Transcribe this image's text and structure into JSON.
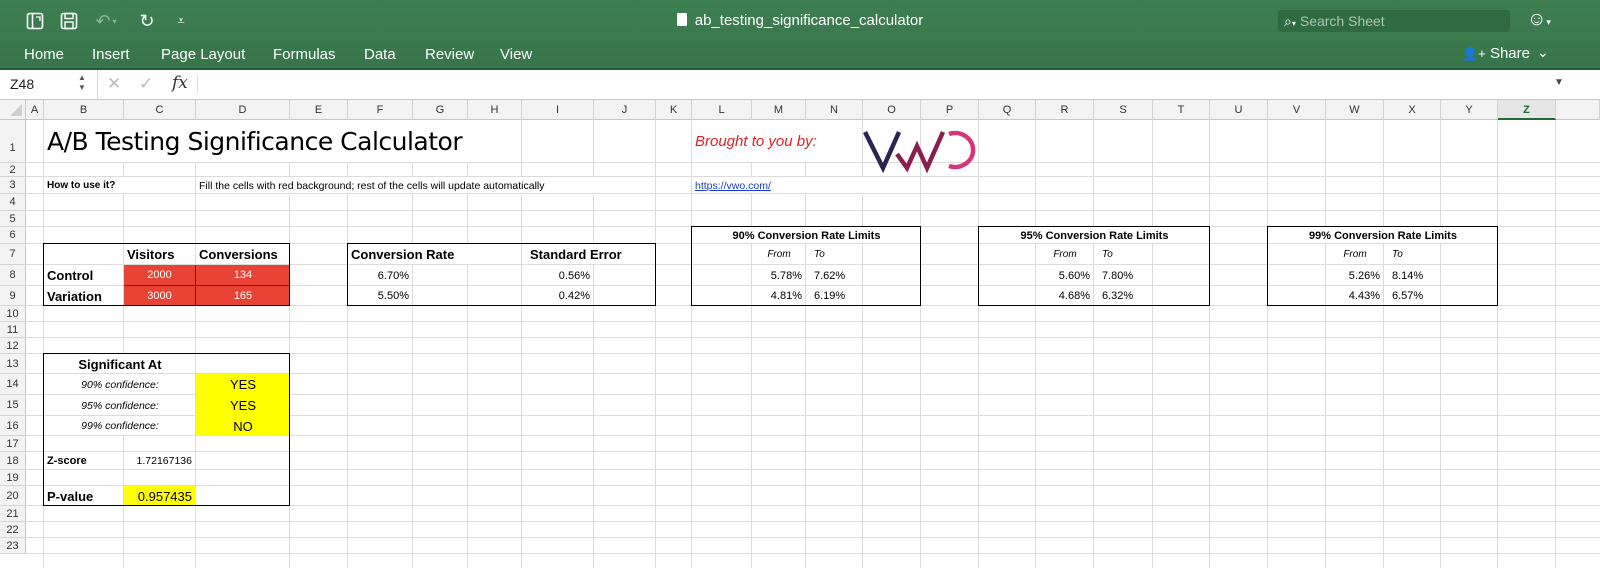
{
  "app": {
    "document_title": "ab_testing_significance_calculator",
    "search_placeholder": "Search Sheet",
    "share_label": "Share",
    "ribbon_tabs": [
      "Home",
      "Insert",
      "Page Layout",
      "Formulas",
      "Data",
      "Review",
      "View"
    ],
    "quick_access": [
      "sidebar-icon",
      "save-icon",
      "undo-icon",
      "redo-icon",
      "customize-icon"
    ],
    "colors": {
      "ribbon": "#3b7b4e",
      "input_cell": "#e94335",
      "highlight": "#ffff00",
      "title_red": "#e02020",
      "link": "#1a3ccc"
    }
  },
  "formula_bar": {
    "name_box": "Z48",
    "fx_label": "fx",
    "cancel_symbol": "✕",
    "enter_symbol": "✓",
    "formula": ""
  },
  "sheet": {
    "columns": [
      "A",
      "B",
      "C",
      "D",
      "E",
      "F",
      "G",
      "H",
      "I",
      "J",
      "K",
      "L",
      "M",
      "N",
      "O",
      "P",
      "Q",
      "R",
      "S",
      "T",
      "U",
      "V",
      "W",
      "X",
      "Y",
      "Z"
    ],
    "rows": [
      "1",
      "2",
      "3",
      "4",
      "5",
      "6",
      "7",
      "8",
      "9",
      "10",
      "11",
      "12",
      "13",
      "14",
      "15",
      "16",
      "17",
      "18",
      "19",
      "20",
      "21",
      "22",
      "23"
    ],
    "selected_column": "Z",
    "title": "A/B Testing Significance Calculator",
    "brought_by": "Brought to you by:",
    "logo_text": "VWO",
    "how_to_label": "How to use it?",
    "how_to_text": "Fill the cells with red background; rest of the cells will update automatically",
    "link": "https://vwo.com/",
    "inputs": {
      "headers": [
        "Visitors",
        "Conversions"
      ],
      "rows": [
        {
          "label": "Control",
          "visitors": "2000",
          "conversions": "134"
        },
        {
          "label": "Variation",
          "visitors": "3000",
          "conversions": "165"
        }
      ]
    },
    "rates": {
      "headers": [
        "Conversion Rate",
        "Standard Error"
      ],
      "rows": [
        {
          "rate": "6.70%",
          "error": "0.56%"
        },
        {
          "rate": "5.50%",
          "error": "0.42%"
        }
      ]
    },
    "limits": [
      {
        "title": "90% Conversion Rate Limits",
        "from_label": "From",
        "to_label": "To",
        "rows": [
          {
            "from": "5.78%",
            "to": "7.62%"
          },
          {
            "from": "4.81%",
            "to": "6.19%"
          }
        ]
      },
      {
        "title": "95% Conversion Rate Limits",
        "from_label": "From",
        "to_label": "To",
        "rows": [
          {
            "from": "5.60%",
            "to": "7.80%"
          },
          {
            "from": "4.68%",
            "to": "6.32%"
          }
        ]
      },
      {
        "title": "99% Conversion Rate Limits",
        "from_label": "From",
        "to_label": "To",
        "rows": [
          {
            "from": "5.26%",
            "to": "8.14%"
          },
          {
            "from": "4.43%",
            "to": "6.57%"
          }
        ]
      }
    ],
    "significance": {
      "title": "Significant At",
      "rows": [
        {
          "label": "90% confidence:",
          "value": "YES"
        },
        {
          "label": "95% confidence:",
          "value": "YES"
        },
        {
          "label": "99% confidence:",
          "value": "NO"
        }
      ],
      "zscore_label": "Z-score",
      "zscore": "1.72167136",
      "pvalue_label": "P-value",
      "pvalue": "0.957435"
    }
  }
}
